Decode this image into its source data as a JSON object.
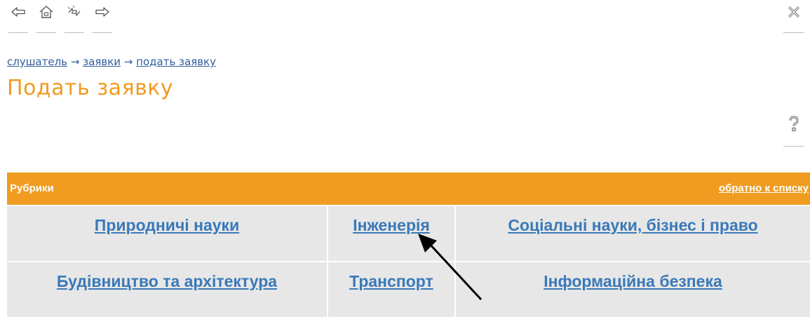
{
  "breadcrumb": {
    "items": [
      "слушатель",
      "заявки",
      "подать заявку"
    ],
    "separator": "→"
  },
  "page": {
    "title": "Подать заявку"
  },
  "rubrics": {
    "header": "Рубрики",
    "back_link": "обратно к списку",
    "categories": [
      "Природничі науки",
      "Інженерія",
      "Соціальні науки, бізнес і право",
      "Будівництво та архітектура",
      "Транспорт",
      "Інформаційна безпека"
    ]
  },
  "icons": {
    "back": "arrow-left-icon",
    "home": "home-icon",
    "refresh": "refresh-icon",
    "forward": "arrow-right-icon",
    "close": "close-icon",
    "help": "question-icon",
    "pointer": "annotation-arrow-icon"
  },
  "colors": {
    "accent_orange": "#ef9c20",
    "title_orange": "#f09a1f",
    "link_blue": "#3a79b8",
    "grid_bg": "#e7e7e7"
  }
}
